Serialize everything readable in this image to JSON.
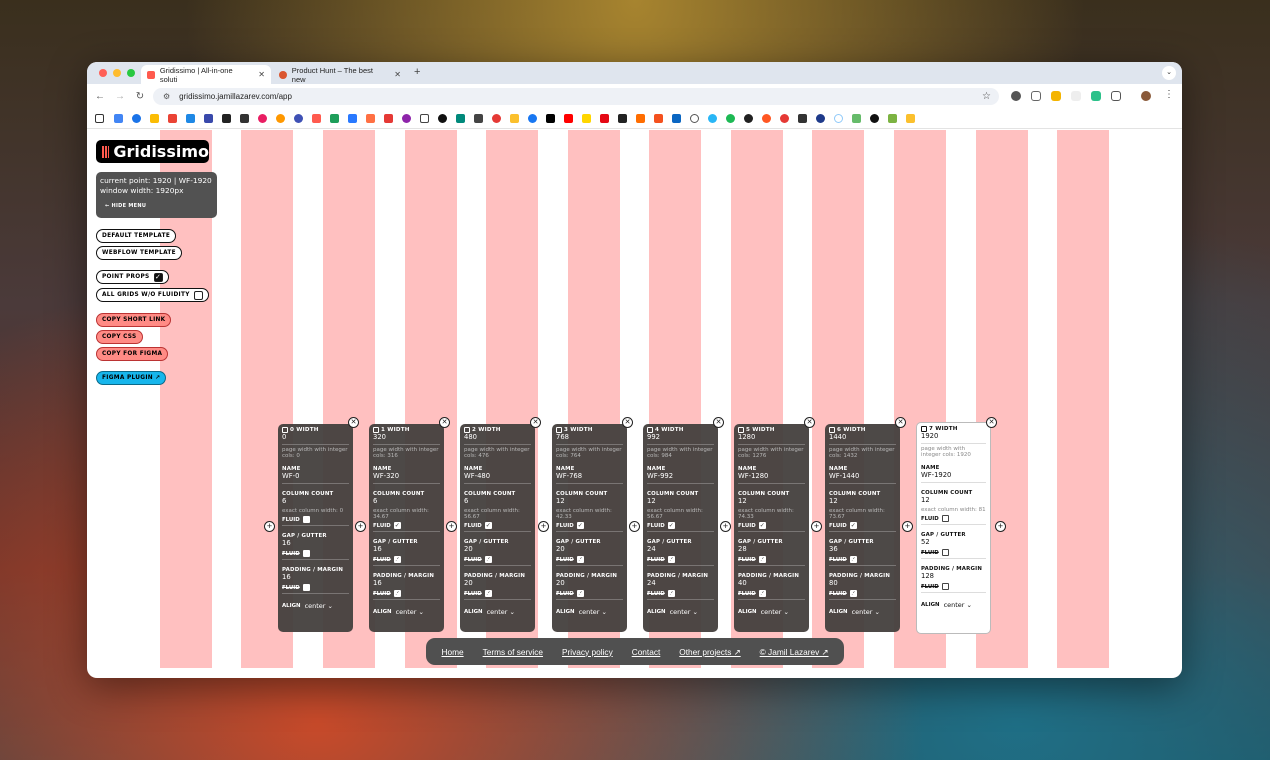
{
  "browser": {
    "tabs": [
      {
        "title": "Gridissimo | All-in-one soluti",
        "active": true,
        "favicon_color": "#ff5a4e"
      },
      {
        "title": "Product Hunt – The best new",
        "active": false,
        "favicon_color": "#da552f"
      }
    ],
    "new_tab_glyph": "+",
    "url": "gridissimo.jamillazarev.com/app"
  },
  "app": {
    "logo": "Gridissimo",
    "info": {
      "current_point": "current point: 1920 | WF-1920",
      "window_width": "window width: 1920px",
      "hide_menu": "← HIDE MENU"
    },
    "buttons": {
      "default_template": "DEFAULT TEMPLATE",
      "webflow_template": "WEBFLOW TEMPLATE",
      "point_props": "POINT PROPS",
      "all_grids": "ALL GRIDS W/O FLUIDITY",
      "copy_short_link": "COPY SHORT LINK",
      "copy_css": "COPY CSS",
      "copy_for_figma": "COPY FOR FIGMA",
      "figma_plugin": "FIGMA PLUGIN ↗"
    },
    "point_props_checked": true,
    "all_grids_checked": false
  },
  "labels": {
    "name": "NAME",
    "column_count": "COLUMN COUNT",
    "fluid": "FLUID",
    "gap": "GAP / GUTTER",
    "padding": "PADDING / MARGIN",
    "align": "ALIGN"
  },
  "breakpoints": [
    {
      "title": "0 WIDTH",
      "width": "0",
      "page_width": "page width with integer cols: 0",
      "name": "WF-0",
      "cols": "6",
      "exact": "exact column width: 0",
      "col_fluid": false,
      "gap": "16",
      "gap_fluid": false,
      "padding": "16",
      "pad_fluid": false,
      "align": "center"
    },
    {
      "title": "1 WIDTH",
      "width": "320",
      "page_width": "page width with integer cols: 316",
      "name": "WF-320",
      "cols": "6",
      "exact": "exact column width: 34.67",
      "col_fluid": true,
      "gap": "16",
      "gap_fluid": true,
      "padding": "16",
      "pad_fluid": true,
      "align": "center"
    },
    {
      "title": "2 WIDTH",
      "width": "480",
      "page_width": "page width with integer cols: 476",
      "name": "WF-480",
      "cols": "6",
      "exact": "exact column width: 56.67",
      "col_fluid": true,
      "gap": "20",
      "gap_fluid": true,
      "padding": "20",
      "pad_fluid": true,
      "align": "center"
    },
    {
      "title": "3 WIDTH",
      "width": "768",
      "page_width": "page width with integer cols: 764",
      "name": "WF-768",
      "cols": "12",
      "exact": "exact column width: 42.33",
      "col_fluid": true,
      "gap": "20",
      "gap_fluid": true,
      "padding": "20",
      "pad_fluid": true,
      "align": "center"
    },
    {
      "title": "4 WIDTH",
      "width": "992",
      "page_width": "page width with integer cols: 984",
      "name": "WF-992",
      "cols": "12",
      "exact": "exact column width: 56.67",
      "col_fluid": true,
      "gap": "24",
      "gap_fluid": true,
      "padding": "24",
      "pad_fluid": true,
      "align": "center"
    },
    {
      "title": "5 WIDTH",
      "width": "1280",
      "page_width": "page width with integer cols: 1276",
      "name": "WF-1280",
      "cols": "12",
      "exact": "exact column width: 74.33",
      "col_fluid": true,
      "gap": "28",
      "gap_fluid": true,
      "padding": "40",
      "pad_fluid": true,
      "align": "center"
    },
    {
      "title": "6 WIDTH",
      "width": "1440",
      "page_width": "page width with integer cols: 1432",
      "name": "WF-1440",
      "cols": "12",
      "exact": "exact column width: 73.67",
      "col_fluid": true,
      "gap": "36",
      "gap_fluid": true,
      "padding": "80",
      "pad_fluid": true,
      "align": "center"
    },
    {
      "title": "7 WIDTH",
      "width": "1920",
      "page_width": "page width with integer cols: 1920",
      "name": "WF-1920",
      "cols": "12",
      "exact": "exact column width: 81",
      "col_fluid": false,
      "gap": "52",
      "gap_fluid": false,
      "padding": "128",
      "pad_fluid": false,
      "align": "center"
    }
  ],
  "footer": {
    "home": "Home",
    "terms": "Terms of service",
    "privacy": "Privacy policy",
    "contact": "Contact",
    "other": "Other projects ↗",
    "author": "© Jamil Lazarev ↗"
  },
  "colors": {
    "grid_column": "#ffc0c0",
    "accent": "#ff5a4e",
    "figma": "#17b6ec"
  }
}
